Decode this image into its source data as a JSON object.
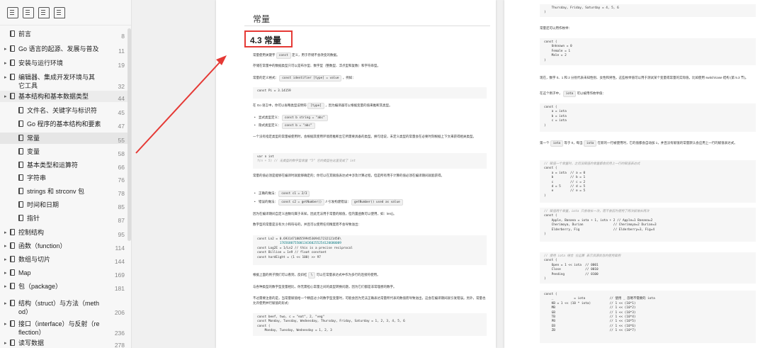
{
  "colors": {
    "accent": "#e53935",
    "sidebar_bg": "#f7f7f7",
    "active_bg": "#e6e6e6"
  },
  "toolbar": {
    "icons": [
      "outline-icon",
      "thumbnail-icon",
      "bookmark-icon",
      "bookmark-add-icon"
    ]
  },
  "toc": [
    {
      "title": "前言",
      "page": "8",
      "indent": 0,
      "expandable": false
    },
    {
      "title": "Go 语言的起源、发展与普及",
      "page": "11",
      "indent": 0,
      "expandable": true
    },
    {
      "title": "安装与运行环境",
      "page": "19",
      "indent": 0,
      "expandable": true
    },
    {
      "title": "编辑器、集成开发环境与其它工具",
      "page": "32",
      "indent": 0,
      "expandable": true
    },
    {
      "title": "基本结构和基本数据类型",
      "page": "44",
      "indent": 0,
      "expandable": true,
      "active": true
    },
    {
      "title": "文件名、关键字与标识符",
      "page": "45",
      "indent": 1,
      "expandable": false
    },
    {
      "title": "Go 程序的基本结构和要素",
      "page": "47",
      "indent": 1,
      "expandable": false
    },
    {
      "title": "常量",
      "page": "55",
      "indent": 1,
      "expandable": false,
      "active": true
    },
    {
      "title": "变量",
      "page": "58",
      "indent": 1,
      "expandable": false
    },
    {
      "title": "基本类型和运算符",
      "page": "66",
      "indent": 1,
      "expandable": false
    },
    {
      "title": "字符串",
      "page": "76",
      "indent": 1,
      "expandable": false
    },
    {
      "title": "strings 和 strconv 包",
      "page": "78",
      "indent": 1,
      "expandable": false
    },
    {
      "title": "时间和日期",
      "page": "85",
      "indent": 1,
      "expandable": false
    },
    {
      "title": "指针",
      "page": "87",
      "indent": 1,
      "expandable": false
    },
    {
      "title": "控制结构",
      "page": "95",
      "indent": 0,
      "expandable": true
    },
    {
      "title": "函数（function）",
      "page": "114",
      "indent": 0,
      "expandable": true
    },
    {
      "title": "数组与切片",
      "page": "144",
      "indent": 0,
      "expandable": true
    },
    {
      "title": "Map",
      "page": "169",
      "indent": 0,
      "expandable": true
    },
    {
      "title": "包（package）",
      "page": "181",
      "indent": 0,
      "expandable": true
    },
    {
      "title": "结构（struct）与方法（method）",
      "page": "206",
      "indent": 0,
      "expandable": true
    },
    {
      "title": "接口（interface）与反射（reflection）",
      "page": "236",
      "indent": 0,
      "expandable": true
    },
    {
      "title": "读写数据",
      "page": "278",
      "indent": 0,
      "expandable": true
    }
  ],
  "page1": {
    "header": "常量",
    "section_title": "4.3 常量",
    "p1a": "常量使用关键字",
    "p1code": "const",
    "p1b": "定义，用于存储不会改变的数据。",
    "p2": "存储在常量中的数据类型只可以是布尔型、数字型（整数型、浮点型和复数）和字符串型。",
    "p3a": "常量的定义格式：",
    "p3code": "const identifier [type] = value",
    "p3b": "，例如：",
    "code1": "const Pi = 3.14159",
    "p4a": "在 Go 语言中，你可以省略类型说明符",
    "p4code": "[type]",
    "p4b": "，因为编译器可以根据变量的值来推断其类型。",
    "b1a": "显式类型定义：",
    "b1code": "const b string = \"abc\"",
    "b2a": "隐式类型定义：",
    "b2code": "const b = \"abc\"",
    "p5": "一个没有指定类型的常量被使用时，会根据其使用环境而推断出它所需要具备的类型。换句话说，未定义类型的常量会在必要时刻根据上下文来获得相关类型。",
    "code2_l1": "var n int",
    "code2_l2": "f(n + 5) // 无类型的数字型常量 “5” 它的类型在这里变成了 int",
    "p6": "常量的值必须是能够在编译时就能够确定的；你可以在其赋值表达式中涉及计算过程，但是所有用于计算的值必须在编译期间就能获得。",
    "b3a": "正确的做法：",
    "b3code": "const c1 = 2/3",
    "b4a": "错误的做法：",
    "b4code": "const c2 = getNumber()",
    "b4b": "// 引发构建错误：",
    "b4code2": "getNumber() used as value",
    "p7": "因为在编译期间自定义函数均属于未知，因此无法用于常量的赋值，但内置函数可以使用，如：len()。",
    "p8": "数字型的常量是没有大小和符号的，并且可以使用任何精度而不会导致溢出：",
    "code3_l1": "const Ln2 = 0.693147180559945309417232121458\\",
    "code3_l2": "            176568075500134360255254120680009",
    "code3_l3": "const Log2E = 1/Ln2 // this is a precise reciprocal",
    "code3_l4": "const Billion = 1e9 // float constant",
    "code3_l5": "const hardEight = (1 << 100) >> 97",
    "p9a": "根据上面的例子我们可以看到，反斜杠",
    "p9code": "\\",
    "p9b": "可以在常量表达式中作为多行的连接符使用。",
    "p10": "与各种类型的数字型变量相比，你无需担心常量之间的类型转换问题，因为它们都是非常理想的数字。",
    "p11": "不过需要注意的是，当常量赋值给一个精度过小的数字型变量时，可能会因为无法正确表达常量所代表的数值而导致溢出，这会在编译期间就引发错误。另外，常量也允许使用并行赋值的形式：",
    "code4_l1": "const beef, two, c = \"eat\", 2, \"veg\"",
    "code4_l2": "const Monday, Tuesday, Wednesday, Thursday, Friday, Saturday = 1, 2, 3, 4, 5, 6",
    "code4_l3": "const (",
    "code4_l4": "    Monday, Tuesday, Wednesday = 1, 2, 3"
  },
  "page2": {
    "code0_l1": "    Thursday, Friday, Saturday = 4, 5, 6",
    "code0_l2": ")",
    "p1": "常量还可以用作枚举：",
    "code1_l1": "const (",
    "code1_l2": "    Unknown = 0",
    "code1_l3": "    Female = 1",
    "code1_l4": "    Male = 2",
    "code1_l5": ")",
    "p2a": "现在，数字 0、1 和 2 分别代表未知性别、女性和男性。这些枚举值可以用于测试某个变量或常量的实际值，比如使用 switch/case 结构 (第 5.3 节)。",
    "p3a": "在这个例子中，",
    "p3code": "iota",
    "p3b": "可以被用作枚举值：",
    "code2_l1": "const (",
    "code2_l2": "    a = iota",
    "code2_l3": "    b = iota",
    "code2_l4": "    c = iota",
    "code2_l5": ")",
    "p4a": "第一个",
    "p4code": "iota",
    "p4b": "等于 0，每当",
    "p4code2": "iota",
    "p4c": "在新的一行被使用时，它的值都会自动加 1，并且没有赋值的常量默认会应用上一行的赋值表达式。",
    "code3_l1": "// 赋值一个常量时，之后没赋值的常量都会应用上一行的赋值表达式",
    "code3_l2": "const (",
    "code3_l3": "    a = iota  // a = 0",
    "code3_l4": "    b         // b = 1",
    "code3_l5": "    c         // c = 2",
    "code3_l6": "    d = 5     // d = 5",
    "code3_l7": "    e         // e = 5",
    "code3_l8": ")",
    "code4_l1": "// 赋值两个常量，iota 只会增长一次，而不会因为使用了两次就增长两次",
    "code4_l2": "const (",
    "code4_l3": "    Apple, Banana = iota + 1, iota + 2 // Apple=1 Banana=2",
    "code4_l4": "    Cherimoya, Durian                // Cherimoya=2 Durian=3",
    "code4_l5": "    Elderberry, Fig                  // Elderberry=3, Fig=4",
    "code4_l6": ")",
    "code5_l1": "// 使用 iota 结合 位运算 表示资源状态的使用案例",
    "code5_l2": "const (",
    "code5_l3": "    Open = 1 << iota  // 0001",
    "code5_l4": "    Close             // 0010",
    "code5_l5": "    Pending           // 0100",
    "code5_l6": ")",
    "code6_l1": "const (",
    "code6_l2": "    _           = iota             // 使用 _ 忽略不需要的 iota",
    "code6_l3": "    KB = 1 << (10 * iota)          // 1 << (10*1)",
    "code6_l4": "    MB                             // 1 << (10*2)",
    "code6_l5": "    GB                             // 1 << (10*3)",
    "code6_l6": "    TB                             // 1 << (10*4)",
    "code6_l7": "    PB                             // 1 << (10*5)",
    "code6_l8": "    EB                             // 1 << (10*6)",
    "code6_l9": "    ZB                             // 1 << (10*7)"
  }
}
